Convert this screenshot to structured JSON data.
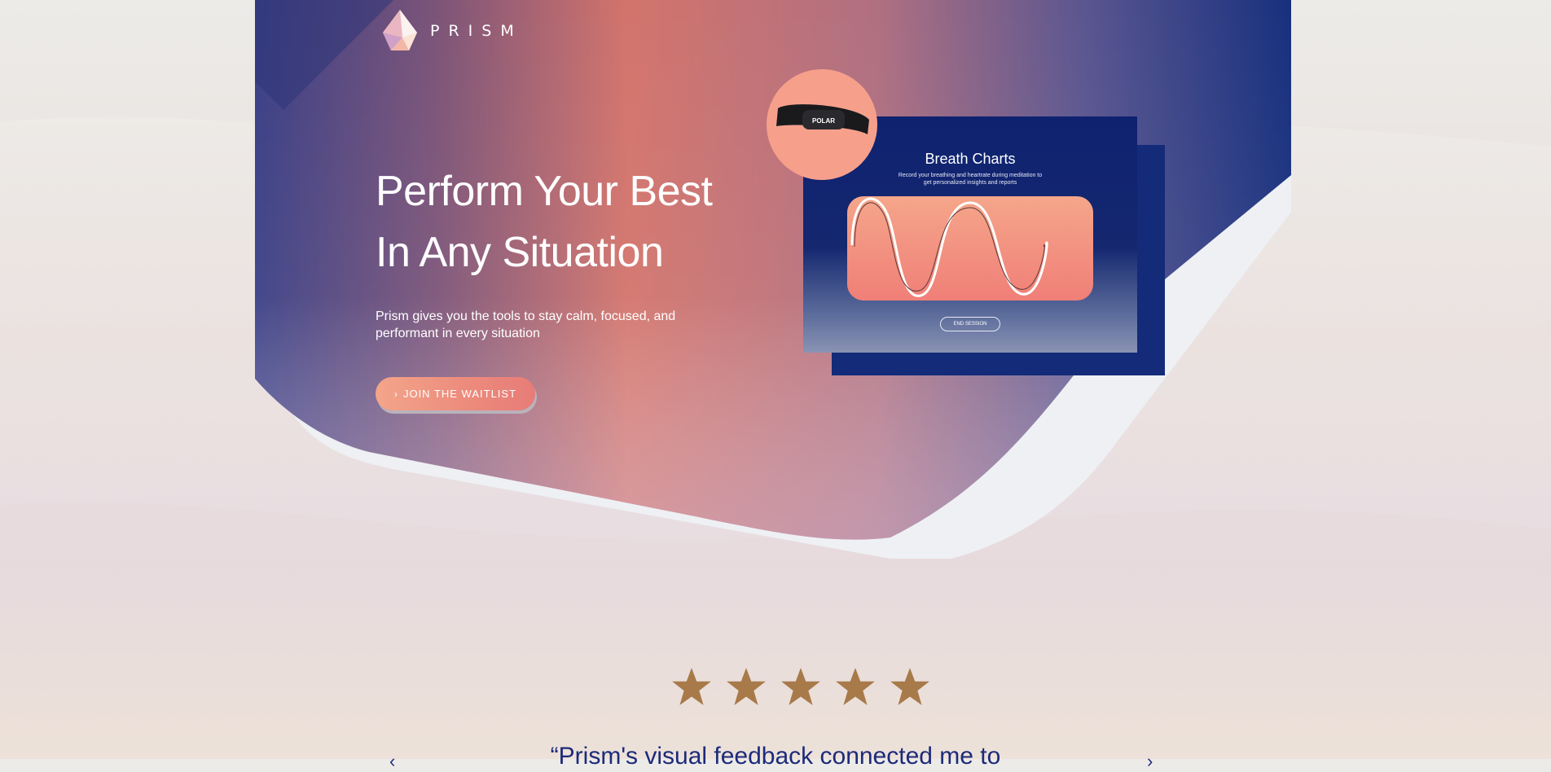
{
  "brand": {
    "name": "PRISM"
  },
  "hero": {
    "headline_line1": "Perform Your Best",
    "headline_line2": "In Any Situation",
    "subtext": "Prism gives you the tools to stay calm, focused, and performant in every situation",
    "cta_label": "JOIN THE WAITLIST",
    "cta_icon": "chevron-right-icon"
  },
  "app_preview": {
    "title": "Breath Charts",
    "subtitle": "Record your breathing and heartrate during meditation to get personalized insights and reports",
    "end_button": "END SESSION",
    "device_label": "POLAR"
  },
  "testimonials": {
    "rating": 5,
    "rating_max": 5,
    "quote": "“Prism's visual feedback connected me to",
    "prev_icon": "chevron-left-icon",
    "next_icon": "chevron-right-icon"
  },
  "colors": {
    "navy": "#0f2270",
    "coral": "#ec8a7c",
    "star": "#a87a4a",
    "quote_text": "#1c2a7a"
  }
}
